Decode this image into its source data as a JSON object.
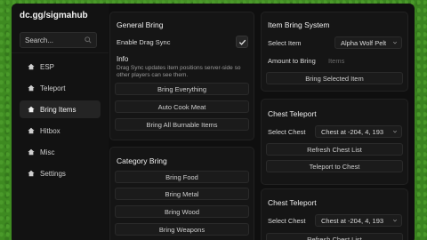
{
  "brand": "dc.gg/sigmahub",
  "search": {
    "placeholder": "Search..."
  },
  "nav": [
    {
      "label": "ESP",
      "icon": "home-icon"
    },
    {
      "label": "Teleport",
      "icon": "home-icon"
    },
    {
      "label": "Bring Items",
      "icon": "home-icon",
      "active": true
    },
    {
      "label": "Hitbox",
      "icon": "home-icon"
    },
    {
      "label": "Misc",
      "icon": "home-icon"
    },
    {
      "label": "Settings",
      "icon": "home-icon"
    }
  ],
  "general": {
    "title": "General Bring",
    "drag_sync_label": "Enable Drag Sync",
    "drag_sync_checked": true,
    "info_title": "Info",
    "info_text": "Drag Sync updates item positions server-side so other players can see them.",
    "buttons": [
      "Bring Everything",
      "Auto Cook Meat",
      "Bring All Burnable Items"
    ]
  },
  "category": {
    "title": "Category Bring",
    "buttons": [
      "Bring Food",
      "Bring Metal",
      "Bring Wood",
      "Bring Weapons"
    ]
  },
  "item_bring": {
    "title": "Item Bring System",
    "select_item_label": "Select Item",
    "select_item_value": "Alpha Wolf Pelt",
    "amount_label": "Amount to Bring",
    "amount_placeholder": "Items",
    "button": "Bring Selected Item"
  },
  "chest1": {
    "title": "Chest Teleport",
    "select_label": "Select Chest",
    "select_value": "Chest at -204, 4, 193",
    "refresh": "Refresh Chest List",
    "teleport": "Teleport to Chest"
  },
  "chest2": {
    "title": "Chest Teleport",
    "select_label": "Select Chest",
    "select_value": "Chest at -204, 4, 193",
    "refresh": "Refresh Chest List"
  }
}
